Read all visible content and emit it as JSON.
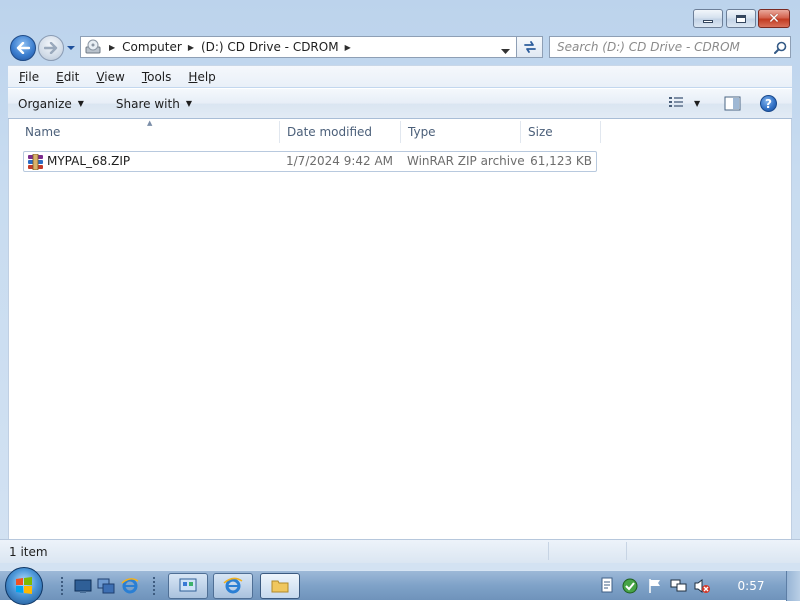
{
  "window": {
    "caption_buttons": {
      "minimize": "minimize",
      "maximize": "maximize",
      "close": "✕"
    }
  },
  "nav": {
    "back_icon": "back-arrow-icon",
    "forward_icon": "forward-arrow-icon",
    "breadcrumbs": [
      "Computer",
      "(D:) CD Drive - CDROM"
    ],
    "search_placeholder": "Search (D:) CD Drive - CDROM"
  },
  "menu": {
    "items": [
      {
        "label": "File",
        "accel": "F",
        "rest": "ile"
      },
      {
        "label": "Edit",
        "accel": "E",
        "rest": "dit"
      },
      {
        "label": "View",
        "accel": "V",
        "rest": "iew"
      },
      {
        "label": "Tools",
        "accel": "T",
        "rest": "ools"
      },
      {
        "label": "Help",
        "accel": "H",
        "rest": "elp"
      }
    ]
  },
  "toolbar": {
    "organize_label": "Organize",
    "share_label": "Share with",
    "help_label": "?"
  },
  "columns": {
    "name": "Name",
    "date": "Date modified",
    "type": "Type",
    "size": "Size",
    "sort_column": "Name",
    "sort_direction": "ascending"
  },
  "files": [
    {
      "name": "MYPAL_68.ZIP",
      "date": "1/7/2024 9:42 AM",
      "type": "WinRAR ZIP archive",
      "size": "61,123 KB",
      "icon": "winrar-archive-icon"
    }
  ],
  "status": {
    "item_count": "1 item"
  },
  "taskbar": {
    "clock": "0:57",
    "colors": {
      "accent": "#2f6ec3",
      "close": "#c23b22"
    }
  }
}
